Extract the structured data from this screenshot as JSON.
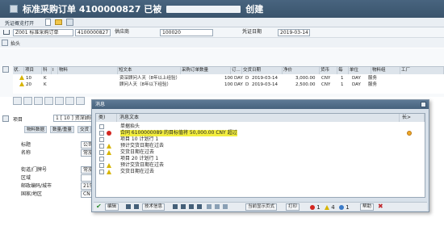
{
  "window": {
    "title_prefix": "标准采购订单 4100000827 已被",
    "title_suffix": "创建"
  },
  "toolbar": {
    "doc_overview": "凭证概览打开"
  },
  "header": {
    "doc_type": "Z001 标准采购订单",
    "po_number": "4100000827",
    "vendor_label": "供应商",
    "vendor_value": "100020",
    "doc_date_label": "凭证日期",
    "doc_date_value": "2019-03-14"
  },
  "section": {
    "title": "抬头"
  },
  "items_table": {
    "columns": [
      "状.",
      "项目",
      "科",
      "I",
      "物料",
      "短文本",
      "采购订单数量",
      "订...",
      "",
      ""
    ],
    "columns_right": [
      "交货日期",
      "净价",
      "货币",
      "每",
      "单位",
      "物料组",
      "工厂"
    ],
    "rows": [
      {
        "item": "10",
        "acct": "K",
        "short": "资深顾问人天（8年以上经验）",
        "qty": "100",
        "unit": "DAY",
        "cat": "D",
        "date": "2019-03-14",
        "price": "3,000.00",
        "cur": "CNY",
        "per": "1",
        "unit2": "DAY",
        "group": "服务"
      },
      {
        "item": "20",
        "acct": "K",
        "short": "顾问人天（8年以下经验）",
        "qty": "100",
        "unit": "DAY",
        "cat": "D",
        "date": "2019-03-14",
        "price": "2,500.00",
        "cur": "CNY",
        "per": "1",
        "unit2": "DAY",
        "group": "服务"
      }
    ]
  },
  "item_detail": {
    "label": "项目",
    "value": "1 [ 10 ] 资深顾问",
    "tabs": [
      "物料数据",
      "数量/重量",
      "交货"
    ],
    "fields": [
      {
        "label": "标题",
        "value": "公司"
      },
      {
        "label": "名称",
        "value": "常旅"
      },
      {
        "label": "街道/门牌号",
        "value": "常旅"
      },
      {
        "label": "区域",
        "value": ""
      },
      {
        "label": "邮政编码/城市",
        "value": "215"
      },
      {
        "label": "国家/地区",
        "value": "CN"
      }
    ]
  },
  "dialog": {
    "title": "消息",
    "col_type": "类)",
    "col_text": "消息文本",
    "col_long": "长>",
    "messages": [
      {
        "text": "单据抬头",
        "icon": "none"
      },
      {
        "text": "合同 6100000089 的目标值将 50,000.00 CNY 超过",
        "icon": "error"
      },
      {
        "text": "项目 10 计划行 1",
        "icon": "none"
      },
      {
        "text": "预计交货日期在过去",
        "icon": "warning"
      },
      {
        "text": "交货日期在过去",
        "icon": "warning"
      },
      {
        "text": "项目 20 计划行 1",
        "icon": "none"
      },
      {
        "text": "预计交货日期在过去",
        "icon": "warning"
      },
      {
        "text": "交货日期在过去",
        "icon": "warning"
      }
    ],
    "footer": {
      "edit": "编辑",
      "tech_info": "技术信息",
      "current_format": "当前显示页式",
      "print": "打印",
      "help": "帮助",
      "count_error": "1",
      "count_warning": "4",
      "count_info": "1"
    }
  },
  "colors": {
    "title_bg": "#48647f",
    "highlight": "#f3ee3e",
    "error_red": "#d3261f",
    "warning_yellow": "#d7b400",
    "dialog_bg": "#d8e1ea"
  }
}
